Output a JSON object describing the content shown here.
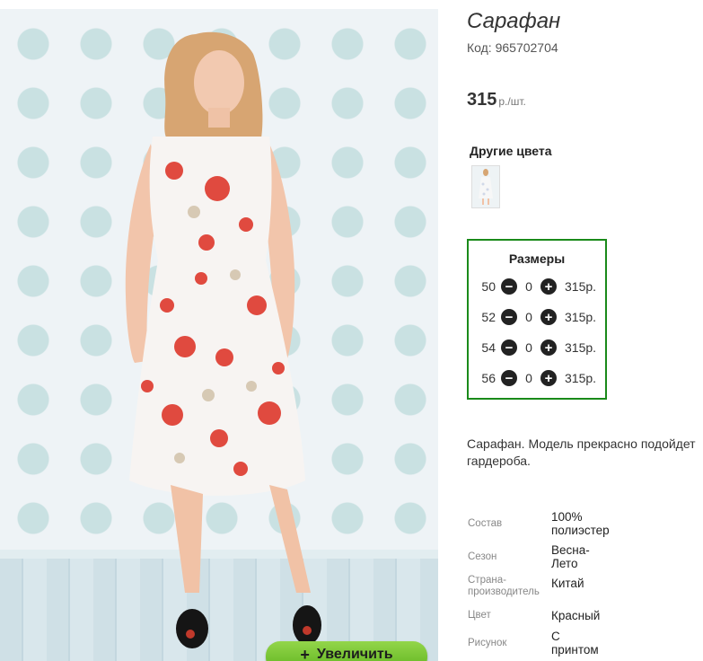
{
  "product": {
    "title": "Сарафан",
    "code": "Код: 965702704",
    "price": "315",
    "price_unit": "р./шт."
  },
  "other_colors": {
    "title": "Другие цвета"
  },
  "sizes": {
    "title": "Размеры",
    "rows": [
      {
        "size": "50",
        "qty": "0",
        "price": "315р."
      },
      {
        "size": "52",
        "qty": "0",
        "price": "315р."
      },
      {
        "size": "54",
        "qty": "0",
        "price": "315р."
      },
      {
        "size": "56",
        "qty": "0",
        "price": "315р."
      }
    ]
  },
  "description": {
    "line1": "Сарафан. Модель прекрасно подойдет",
    "line2": "гардероба."
  },
  "attributes": [
    {
      "label": "Состав",
      "value_lines": [
        "100%",
        "полиэстер"
      ]
    },
    {
      "label": "Сезон",
      "value_lines": [
        "Весна-",
        "Лето"
      ]
    },
    {
      "label": "Страна-производитель",
      "label_lines": [
        "Страна-",
        "производитель"
      ],
      "value_lines": [
        "Китай"
      ]
    },
    {
      "label": "Цвет",
      "value_lines": [
        "Красный"
      ]
    },
    {
      "label": "Рисунок",
      "value_lines": [
        "С",
        "принтом"
      ]
    }
  ],
  "zoom_button": {
    "icon": "plus-icon",
    "label": "Увеличить"
  },
  "colors": {
    "sizes_border": "#1a8a1a",
    "zoom_button": "#7cc735"
  }
}
